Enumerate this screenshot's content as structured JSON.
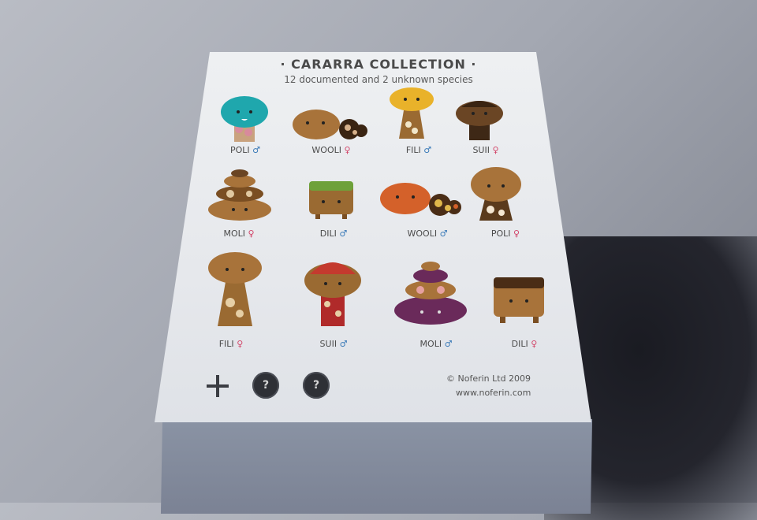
{
  "box": {
    "title": "· CARARRA COLLECTION ·",
    "subtitle": "12 documented and 2 unknown species"
  },
  "figures": [
    {
      "name": "POLI",
      "symbol": "♂"
    },
    {
      "name": "WOOLI",
      "symbol": "♀"
    },
    {
      "name": "FILI",
      "symbol": "♂"
    },
    {
      "name": "SUII",
      "symbol": "♀"
    },
    {
      "name": "MOLI",
      "symbol": "♀"
    },
    {
      "name": "DILI",
      "symbol": "♂"
    },
    {
      "name": "WOOLI",
      "symbol": "♂"
    },
    {
      "name": "POLI",
      "symbol": "♀"
    },
    {
      "name": "FILI",
      "symbol": "♀"
    },
    {
      "name": "SUII",
      "symbol": "♂"
    },
    {
      "name": "MOLI",
      "symbol": "♂"
    },
    {
      "name": "DILI",
      "symbol": "♀"
    }
  ],
  "unknown_marks": [
    "?",
    "?"
  ],
  "footer": {
    "copyright": "© Noferin Ltd 2009",
    "website": "www.noferin.com"
  },
  "colors": {
    "box_top": "#eceef1",
    "wood": "#9a6a32",
    "teal": "#1fa7ad",
    "yellow": "#e9b22a",
    "orange": "#d4612a",
    "red": "#c43a2e",
    "purple": "#6a2a5a",
    "green": "#6ea13a",
    "dark_wood": "#4a2d16"
  }
}
